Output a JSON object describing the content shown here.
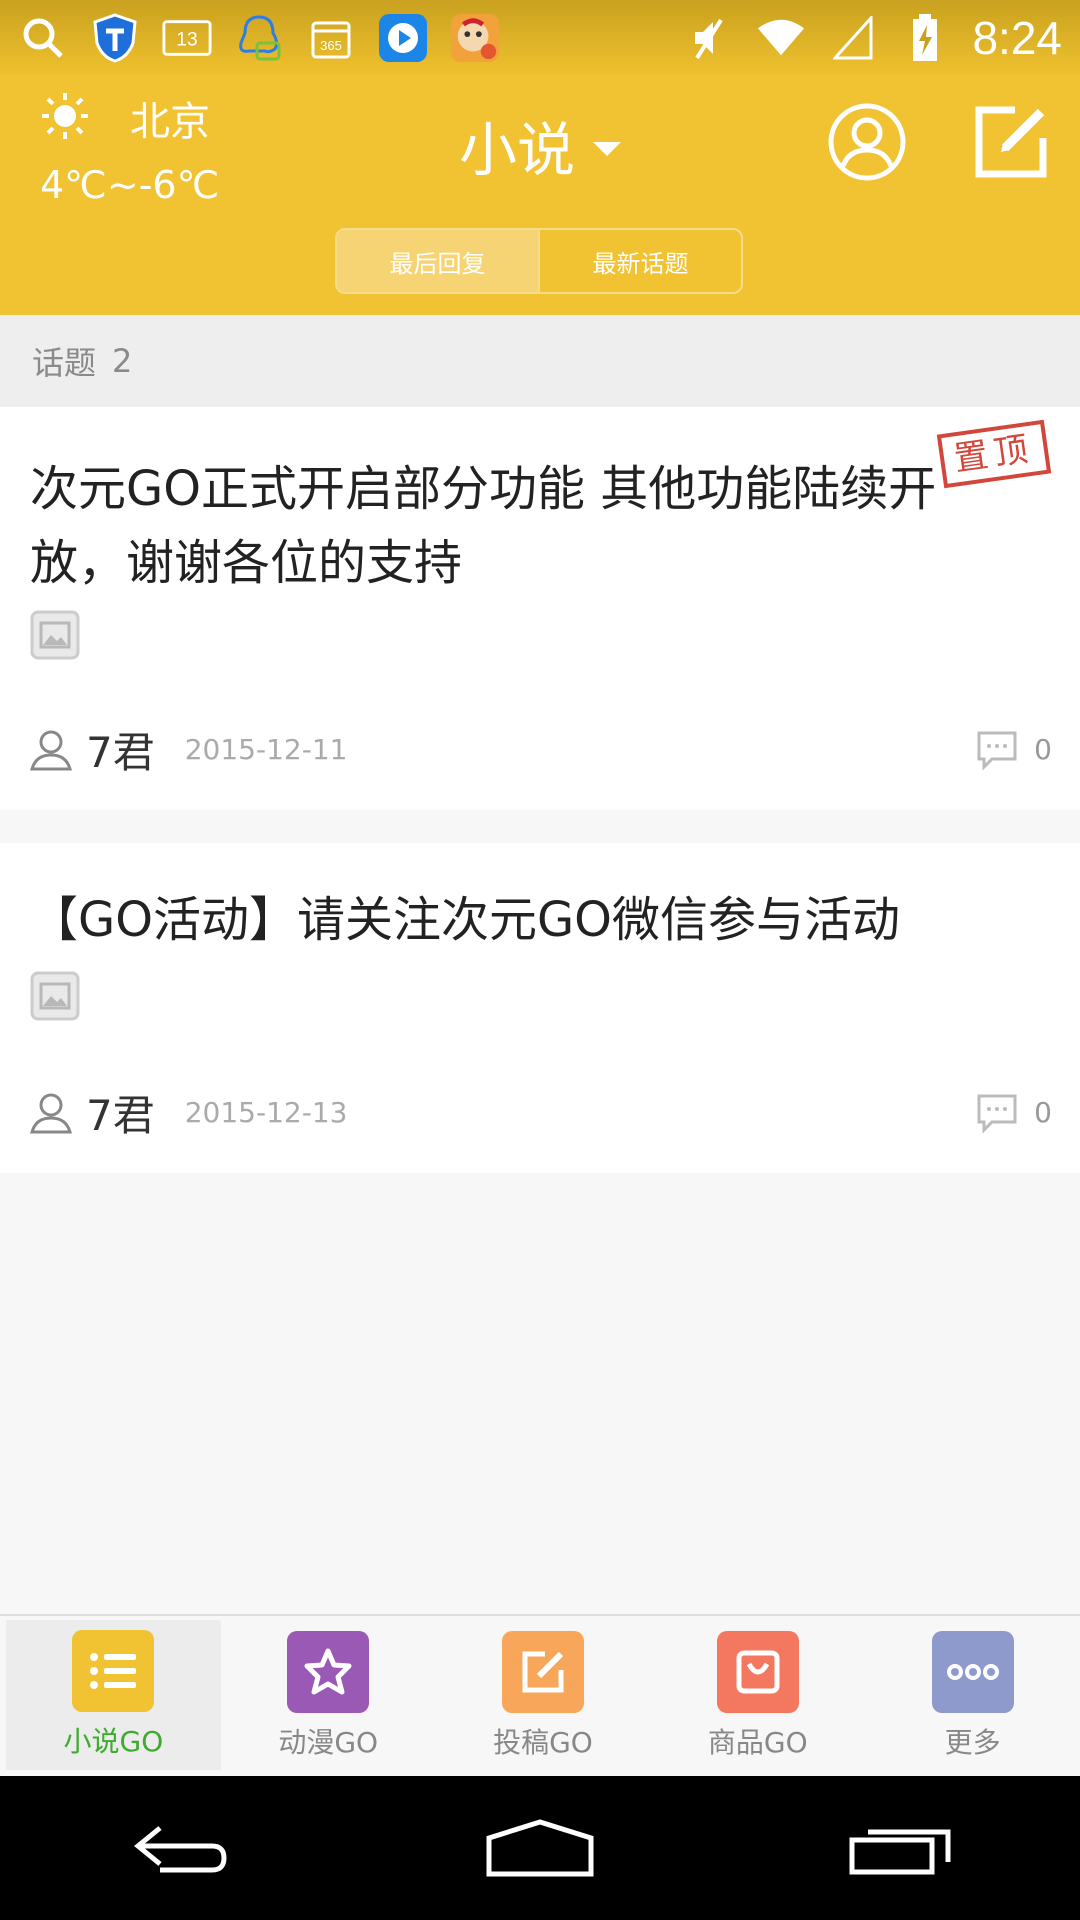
{
  "status_bar": {
    "time": "8:24",
    "notification_badge": "13",
    "calendar_badge": "365"
  },
  "header": {
    "weather": {
      "city": "北京",
      "temp": "4℃~-6℃"
    },
    "title": "小说",
    "tabs": [
      {
        "label": "最后回复",
        "active": true
      },
      {
        "label": "最新话题",
        "active": false
      }
    ]
  },
  "topic_bar": {
    "label": "话题",
    "count": "2"
  },
  "posts": [
    {
      "title": "次元GO正式开启部分功能 其他功能陆续开放，谢谢各位的支持",
      "sticky_label": "置顶",
      "author": "7君",
      "date": "2015-12-11",
      "comments": "0"
    },
    {
      "title": "【GO活动】请关注次元GO微信参与活动",
      "author": "7君",
      "date": "2015-12-13",
      "comments": "0"
    }
  ],
  "bottom_nav": [
    {
      "label": "小说GO",
      "active": true,
      "color": "#f1c232",
      "icon": "list-icon"
    },
    {
      "label": "动漫GO",
      "active": false,
      "color": "#9b59b6",
      "icon": "star-icon"
    },
    {
      "label": "投稿GO",
      "active": false,
      "color": "#f7a65a",
      "icon": "edit-icon"
    },
    {
      "label": "商品GO",
      "active": false,
      "color": "#f4785f",
      "icon": "bag-icon"
    },
    {
      "label": "更多",
      "active": false,
      "color": "#8e99cc",
      "icon": "more-icon"
    }
  ],
  "colors": {
    "header": "#f1c232",
    "active_tab_text": "#3dac2e",
    "sticky_stamp": "#d2473b"
  }
}
